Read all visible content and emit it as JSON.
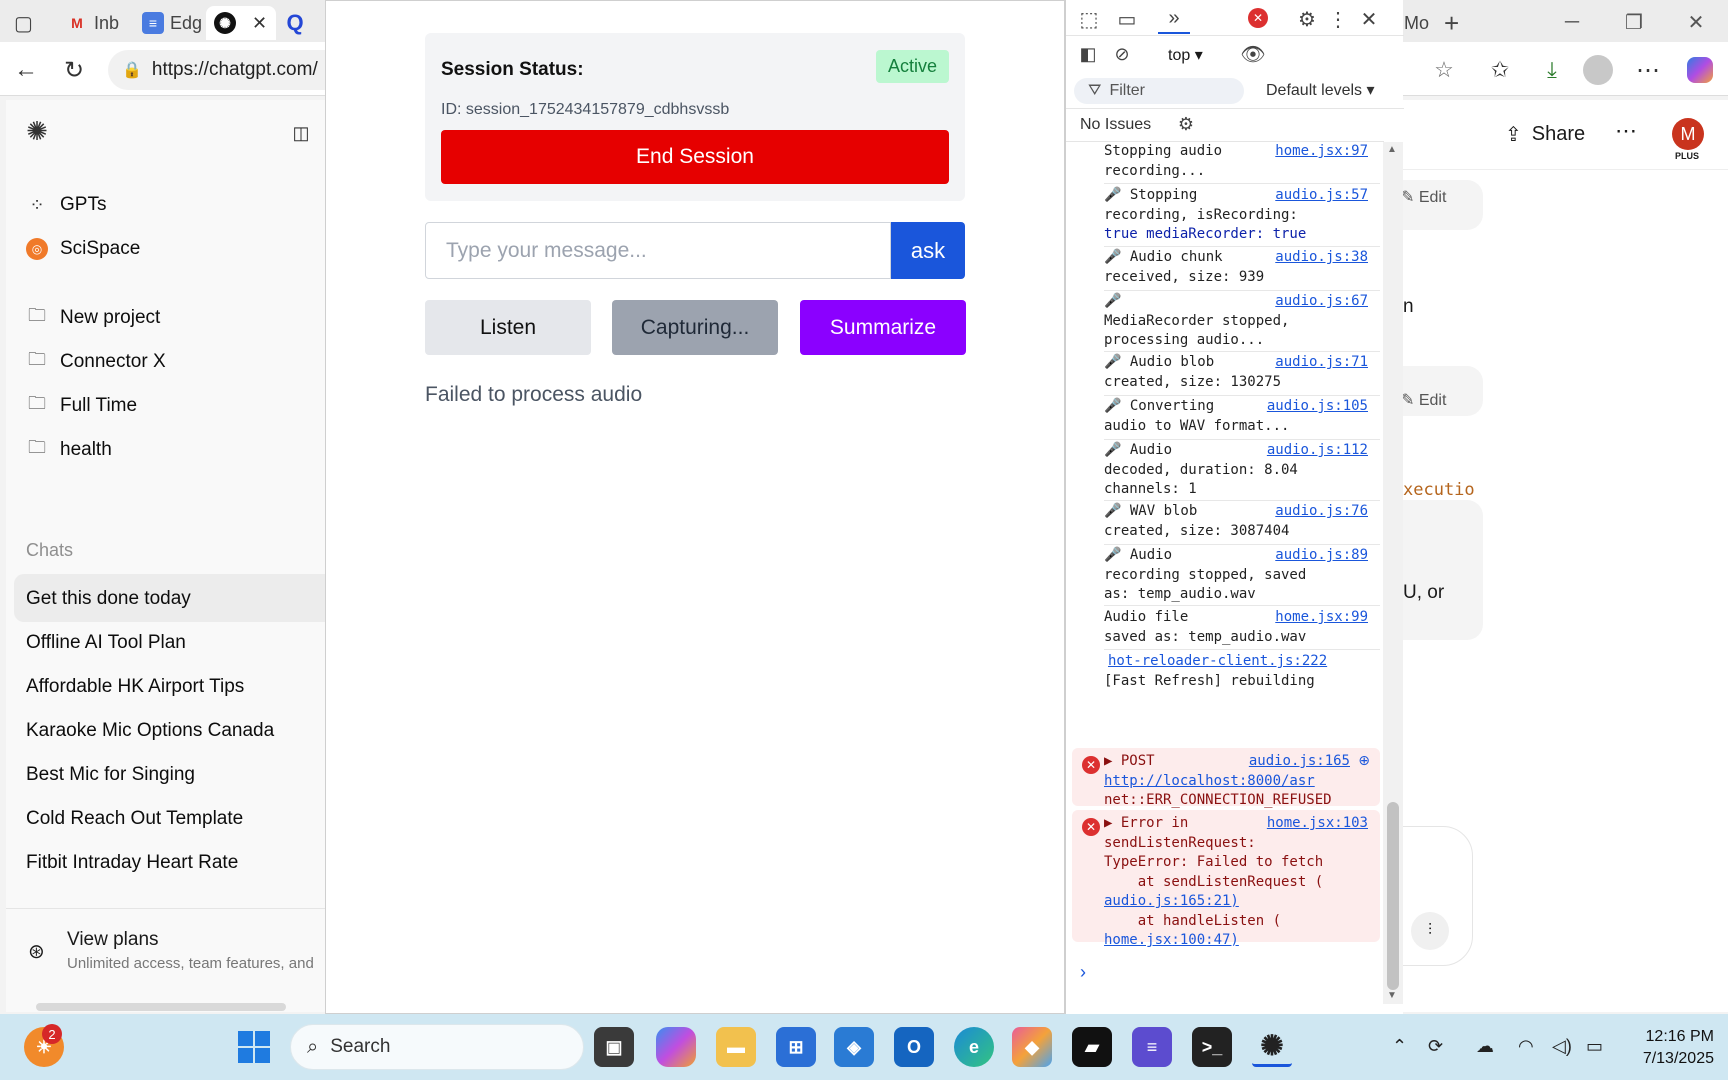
{
  "browser": {
    "tabs": [
      {
        "label": "Inb",
        "icon": "gmail-icon"
      },
      {
        "label": "Edg",
        "icon": "docs-icon"
      },
      {
        "label": "",
        "icon": "chatgpt-icon"
      },
      {
        "label": "",
        "icon": "q-icon"
      }
    ],
    "right_tab_label": "Mo",
    "url": "https://chatgpt.com/"
  },
  "chatgpt": {
    "sidebar_top": [
      {
        "label": "GPTs",
        "icon": "grid-icon"
      },
      {
        "label": "SciSpace",
        "icon": "scispace-icon"
      }
    ],
    "projects": [
      {
        "label": "New project",
        "icon": "new-folder-icon"
      },
      {
        "label": "Connector X",
        "icon": "folder-icon"
      },
      {
        "label": "Full Time",
        "icon": "folder-icon"
      },
      {
        "label": "health",
        "icon": "folder-icon"
      }
    ],
    "chats_heading": "Chats",
    "chats": [
      "Get this done today",
      "Offline AI Tool Plan",
      "Affordable HK Airport Tips",
      "Karaoke Mic Options Canada",
      "Best Mic for Singing",
      "Cold Reach Out Template",
      "Fitbit Intraday Heart Rate"
    ],
    "view_plans": {
      "title": "View plans",
      "subtitle": "Unlimited access, team features, and"
    },
    "share_label": "Share",
    "avatar_letter": "M",
    "avatar_badge": "PLUS",
    "right_fragments": {
      "edit1": "Edit",
      "frag1": "n",
      "edit2": "Edit",
      "frag2": "xecutio",
      "frag3": "U, or"
    }
  },
  "app": {
    "session_status_label": "Session Status:",
    "status_badge": "Active",
    "session_id": "ID: session_1752434157879_cdbhsvssb",
    "end_session_label": "End Session",
    "message_placeholder": "Type your message...",
    "ask_label": "ask",
    "listen_label": "Listen",
    "capturing_label": "Capturing...",
    "summarize_label": "Summarize",
    "status_message": "Failed to process audio"
  },
  "devtools": {
    "context": "top",
    "filter_placeholder": "Filter",
    "levels": "Default levels",
    "issues": "No Issues",
    "logs": [
      {
        "src": "home.jsx:97",
        "lines": [
          "Stopping audio",
          "recording..."
        ]
      },
      {
        "src": "audio.js:57",
        "lines": [
          "🎤 Stopping",
          "recording, isRecording:",
          "true mediaRecorder: true"
        ]
      },
      {
        "src": "audio.js:38",
        "lines": [
          "🎤 Audio chunk",
          "received, size: 939"
        ]
      },
      {
        "src": "audio.js:67",
        "lines": [
          "🎤",
          "MediaRecorder stopped,",
          "processing audio..."
        ]
      },
      {
        "src": "audio.js:71",
        "lines": [
          "🎤 Audio blob",
          "created, size: 130275"
        ]
      },
      {
        "src": "audio.js:105",
        "lines": [
          "🎤 Converting",
          "audio to WAV format..."
        ]
      },
      {
        "src": "audio.js:112",
        "lines": [
          "🎤 Audio",
          "decoded, duration: 8.04",
          "channels: 1"
        ]
      },
      {
        "src": "audio.js:76",
        "lines": [
          "🎤 WAV blob",
          "created, size: 3087404"
        ]
      },
      {
        "src": "audio.js:89",
        "lines": [
          "🎤 Audio",
          "recording stopped, saved",
          "as: temp_audio.wav"
        ]
      },
      {
        "src": "home.jsx:99",
        "lines": [
          "Audio file",
          "saved as: temp_audio.wav"
        ]
      },
      {
        "src": "hot-reloader-client.js:222",
        "lines": [
          "",
          "[Fast Refresh] rebuilding"
        ]
      }
    ],
    "errors": [
      {
        "src": "audio.js:165",
        "lines": [
          "▶ POST",
          "http://localhost:8000/asr",
          "net::ERR_CONNECTION_REFUSED"
        ]
      },
      {
        "src": "home.jsx:103",
        "lines": [
          "▶ Error in",
          "sendListenRequest:",
          "TypeError: Failed to fetch",
          "    at sendListenRequest (",
          "audio.js:165:21)",
          "    at handleListen (",
          "home.jsx:100:47)"
        ]
      }
    ],
    "prompt": "›"
  },
  "taskbar": {
    "search_placeholder": "Search",
    "notification_count": "2",
    "time": "12:16 PM",
    "date": "7/13/2025"
  }
}
